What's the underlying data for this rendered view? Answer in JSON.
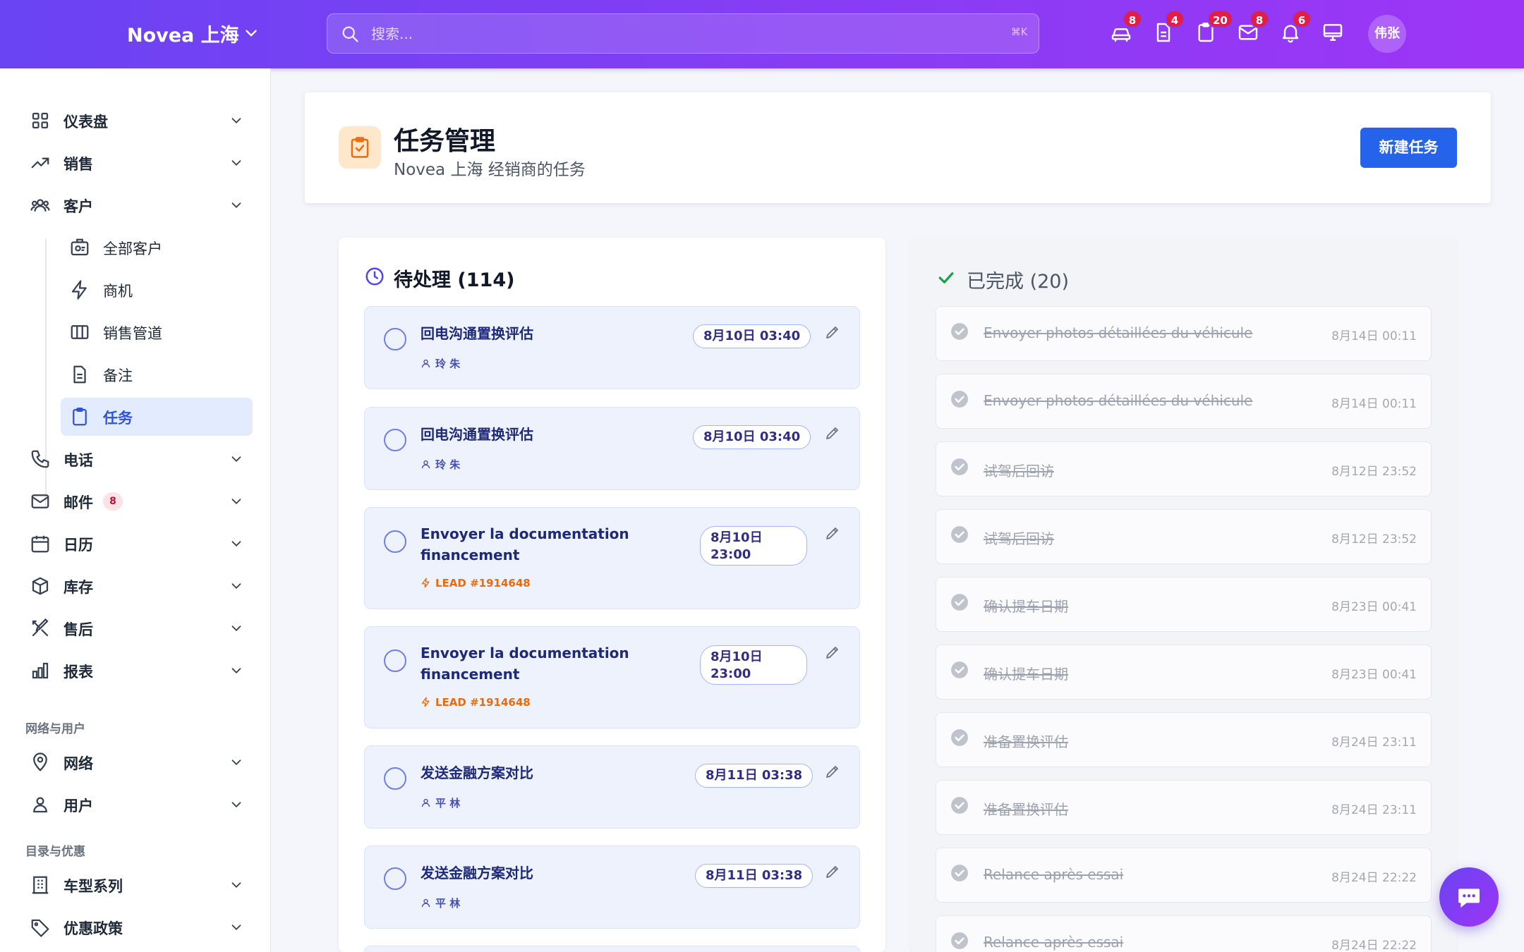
{
  "topbar": {
    "brand": "Novea 上海",
    "search_placeholder": "搜索...",
    "search_shortcut": "⌘K",
    "icons": [
      {
        "name": "car-icon",
        "badge": "8"
      },
      {
        "name": "document-icon",
        "badge": "4"
      },
      {
        "name": "clipboard-icon",
        "badge": "20"
      },
      {
        "name": "mail-icon",
        "badge": "8"
      },
      {
        "name": "bell-icon",
        "badge": "6"
      },
      {
        "name": "monitor-icon",
        "badge": ""
      }
    ],
    "avatar": "伟张"
  },
  "sidebar": {
    "items": [
      {
        "label": "仪表盘",
        "icon": "grid-icon"
      },
      {
        "label": "销售",
        "icon": "trending-up-icon"
      },
      {
        "label": "客户",
        "icon": "users-icon"
      },
      {
        "label": "电话",
        "icon": "phone-icon"
      },
      {
        "label": "邮件",
        "icon": "mail-icon",
        "badge": "8"
      },
      {
        "label": "日历",
        "icon": "calendar-icon"
      },
      {
        "label": "库存",
        "icon": "box-icon"
      },
      {
        "label": "售后",
        "icon": "tools-icon"
      },
      {
        "label": "报表",
        "icon": "bar-chart-icon"
      },
      {
        "label": "网络",
        "icon": "map-pin-icon"
      },
      {
        "label": "用户",
        "icon": "user-group-icon"
      },
      {
        "label": "车型系列",
        "icon": "building-icon"
      },
      {
        "label": "优惠政策",
        "icon": "tag-icon"
      }
    ],
    "sub_items": [
      {
        "label": "全部客户",
        "icon": "contact-card-icon"
      },
      {
        "label": "商机",
        "icon": "lightning-icon"
      },
      {
        "label": "销售管道",
        "icon": "columns-icon"
      },
      {
        "label": "备注",
        "icon": "note-icon"
      },
      {
        "label": "任务",
        "icon": "clipboard-icon",
        "active": true
      }
    ],
    "sections": [
      "网络与用户",
      "目录与优惠"
    ]
  },
  "header": {
    "title": "任务管理",
    "subtitle": "Novea 上海 经销商的任务",
    "new_button": "新建任务"
  },
  "pending": {
    "title": "待处理 (114)",
    "tasks": [
      {
        "title": "回电沟通置换评估",
        "date": "8月10日 03:40",
        "meta": "玲 朱",
        "meta_type": "person"
      },
      {
        "title": "回电沟通置换评估",
        "date": "8月10日 03:40",
        "meta": "玲 朱",
        "meta_type": "person"
      },
      {
        "title_line1": "Envoyer la documentation",
        "title_line2": "financement",
        "date_line1": "8月10日",
        "date_line2": "23:00",
        "meta": "LEAD #1914648",
        "meta_type": "lead"
      },
      {
        "title_line1": "Envoyer la documentation",
        "title_line2": "financement",
        "date_line1": "8月10日",
        "date_line2": "23:00",
        "meta": "LEAD #1914648",
        "meta_type": "lead"
      },
      {
        "title": "发送金融方案对比",
        "date": "8月11日 03:38",
        "meta": "平 林",
        "meta_type": "person"
      },
      {
        "title": "发送金融方案对比",
        "date": "8月11日 03:38",
        "meta": "平 林",
        "meta_type": "person"
      }
    ]
  },
  "completed": {
    "title": "已完成 (20)",
    "tasks": [
      {
        "title": "Envoyer photos détaillées du véhicule",
        "date": "8月14日 00:11"
      },
      {
        "title": "Envoyer photos détaillées du véhicule",
        "date": "8月14日 00:11"
      },
      {
        "title": "试驾后回访",
        "date": "8月12日 23:52"
      },
      {
        "title": "试驾后回访",
        "date": "8月12日 23:52"
      },
      {
        "title": "确认提车日期",
        "date": "8月23日 00:41"
      },
      {
        "title": "确认提车日期",
        "date": "8月23日 00:41"
      },
      {
        "title": "准备置换评估",
        "date": "8月24日 23:11"
      },
      {
        "title": "准备置换评估",
        "date": "8月24日 23:11"
      },
      {
        "title": "Relance après essai",
        "date": "8月24日 22:22"
      },
      {
        "title": "Relance après essai",
        "date": "8月24日 22:22"
      }
    ]
  },
  "colors": {
    "primary": "#2563eb",
    "topbar_start": "#6a43f2",
    "topbar_end": "#9d35f6",
    "badge": "#e11d48",
    "lead": "#ea6a0c",
    "done_check": "#16a34a"
  }
}
